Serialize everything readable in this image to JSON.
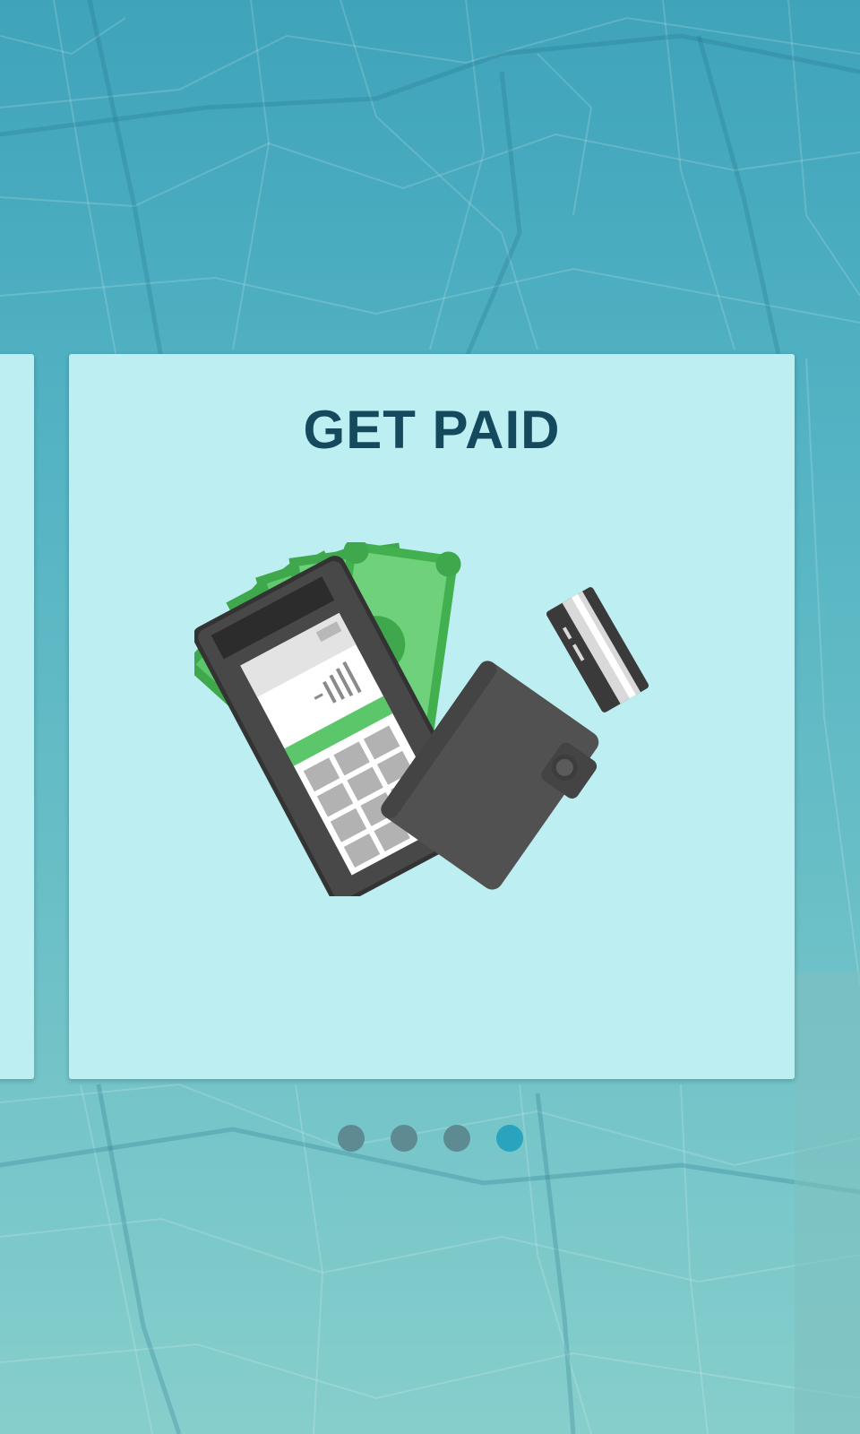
{
  "onboarding": {
    "card_title": "GET PAID",
    "illustration_icon": "payment-terminal-cash-wallet-card-icon",
    "pager": {
      "total": 4,
      "active_index": 3
    }
  },
  "colors": {
    "background_top": "#3fa3ba",
    "background_bottom": "#86cecc",
    "card": "#bdeef2",
    "title": "#154a5e",
    "dot_inactive": "#5e8b92",
    "dot_active": "#2aa3bf",
    "cash_green": "#5cc66a",
    "device_dark": "#444444"
  }
}
